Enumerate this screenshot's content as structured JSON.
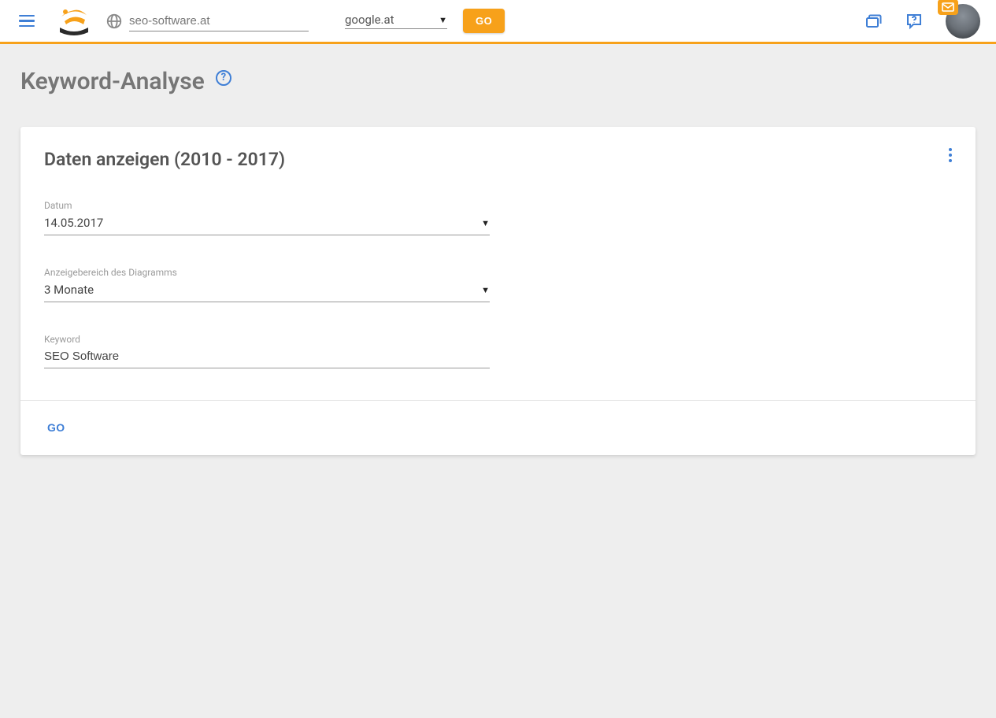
{
  "topbar": {
    "domain_value": "seo-software.at",
    "engine_value": "google.at",
    "go_label": "GO"
  },
  "page": {
    "title": "Keyword-Analyse",
    "help_glyph": "?"
  },
  "card": {
    "title": "Daten anzeigen (2010 - 2017)",
    "fields": {
      "date": {
        "label": "Datum",
        "value": "14.05.2017"
      },
      "range": {
        "label": "Anzeigebereich des Diagramms",
        "value": "3 Monate"
      },
      "keyword": {
        "label": "Keyword",
        "value": "SEO Software"
      }
    },
    "action_label": "GO"
  }
}
